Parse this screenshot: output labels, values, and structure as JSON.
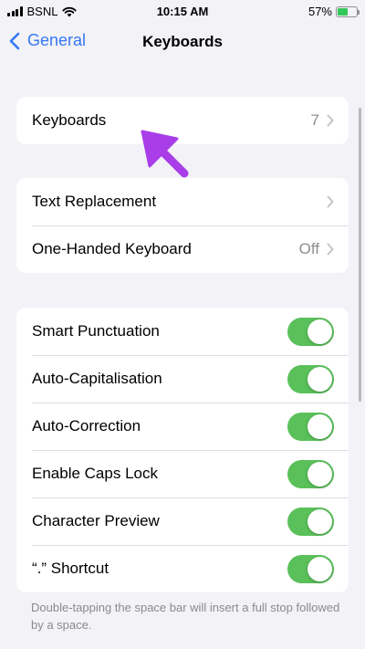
{
  "status_bar": {
    "carrier": "BSNL",
    "time": "10:15 AM",
    "battery_percent": "57%",
    "battery_level": 0.57
  },
  "nav": {
    "back_label": "General",
    "title": "Keyboards"
  },
  "group_keyboards": {
    "label": "Keyboards",
    "value": "7"
  },
  "group_text": {
    "rows": [
      {
        "label": "Text Replacement",
        "value": ""
      },
      {
        "label": "One-Handed Keyboard",
        "value": "Off"
      }
    ]
  },
  "toggles": [
    {
      "label": "Smart Punctuation",
      "on": true
    },
    {
      "label": "Auto-Capitalisation",
      "on": true
    },
    {
      "label": "Auto-Correction",
      "on": true
    },
    {
      "label": "Enable Caps Lock",
      "on": true
    },
    {
      "label": "Character Preview",
      "on": true
    },
    {
      "label": "“.” Shortcut",
      "on": true
    }
  ],
  "footer_note": "Double-tapping the space bar will insert a full stop followed by a space.",
  "colors": {
    "accent": "#3478f6",
    "toggle_on": "#5ac05a",
    "annotation_arrow": "#a93ee8",
    "background": "#f2f2f7"
  }
}
